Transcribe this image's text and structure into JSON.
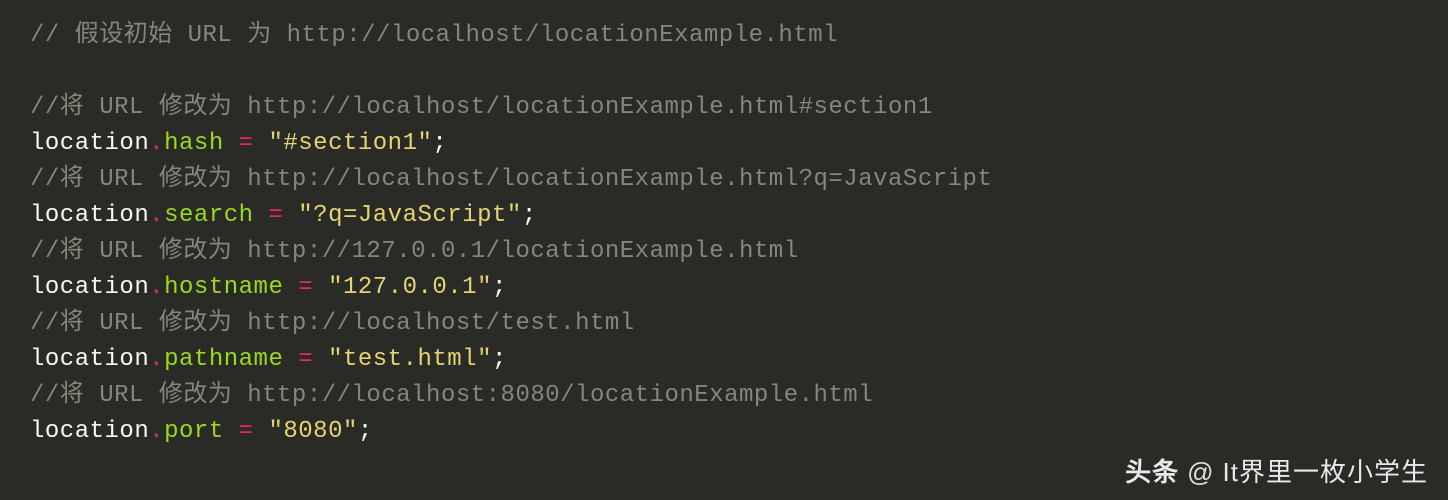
{
  "code": {
    "lines": [
      {
        "type": "comment",
        "text": "// 假设初始 URL 为 http://localhost/locationExample.html"
      },
      {
        "type": "blank"
      },
      {
        "type": "comment",
        "text": "//将 URL 修改为 http://localhost/locationExample.html#section1"
      },
      {
        "type": "assign",
        "object": "location",
        "property": "hash",
        "value": "\"#section1\""
      },
      {
        "type": "comment",
        "text": "//将 URL 修改为 http://localhost/locationExample.html?q=JavaScript"
      },
      {
        "type": "assign",
        "object": "location",
        "property": "search",
        "value": "\"?q=JavaScript\""
      },
      {
        "type": "comment",
        "text": "//将 URL 修改为 http://127.0.0.1/locationExample.html"
      },
      {
        "type": "assign",
        "object": "location",
        "property": "hostname",
        "value": "\"127.0.0.1\""
      },
      {
        "type": "comment",
        "text": "//将 URL 修改为 http://localhost/test.html"
      },
      {
        "type": "assign",
        "object": "location",
        "property": "pathname",
        "value": "\"test.html\""
      },
      {
        "type": "comment",
        "text": "//将 URL 修改为 http://localhost:8080/locationExample.html"
      },
      {
        "type": "assign",
        "object": "location",
        "property": "port",
        "value": "\"8080\""
      }
    ]
  },
  "watermark": {
    "label": "头条",
    "at": "@",
    "author": "It界里一枚小学生"
  }
}
